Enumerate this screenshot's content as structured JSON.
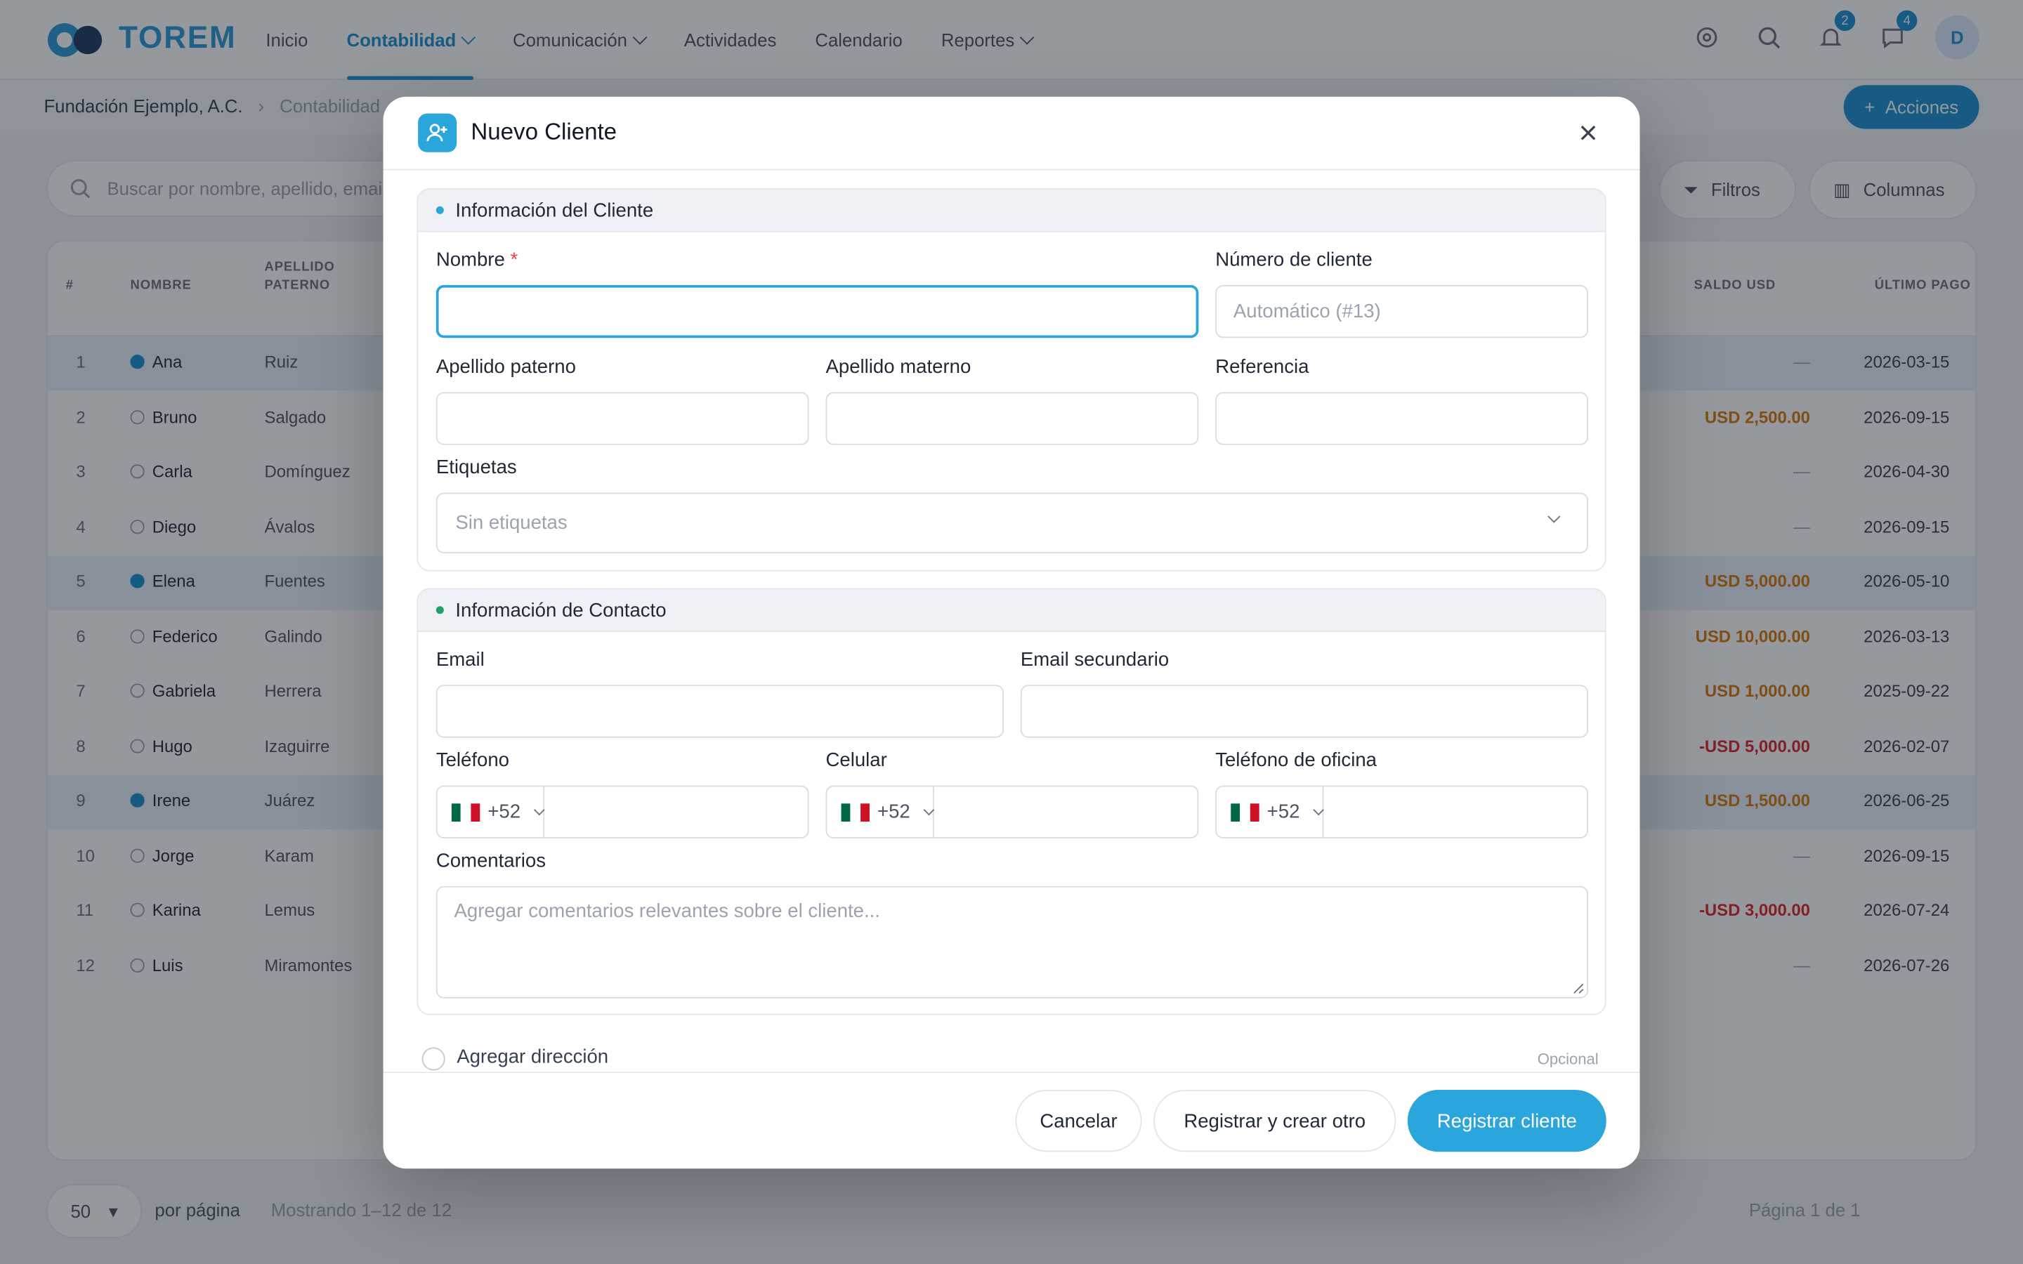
{
  "app": {
    "logo_text": "TOREM",
    "nav": [
      {
        "label": "Inicio",
        "active": false,
        "dropdown": false
      },
      {
        "label": "Contabilidad",
        "active": true,
        "dropdown": true
      },
      {
        "label": "Comunicación",
        "active": false,
        "dropdown": true
      },
      {
        "label": "Actividades",
        "active": false,
        "dropdown": false
      },
      {
        "label": "Calendario",
        "active": false,
        "dropdown": false
      },
      {
        "label": "Reportes",
        "active": false,
        "dropdown": true
      }
    ],
    "badges": {
      "notifications": "2",
      "messages": "4"
    },
    "avatar_initial": "D",
    "breadcrumb": {
      "org": "Fundación Ejemplo, A.C.",
      "section": "Contabilidad"
    },
    "actions_label": "Acciones",
    "search_placeholder": "Buscar por nombre, apellido, email...",
    "filters_label": "Filtros",
    "columns_label": "Columnas",
    "table": {
      "headers": [
        "#",
        "NOMBRE",
        "APELLIDO PATERNO",
        "SALDO USD",
        "ÚLTIMO PAGO"
      ],
      "rows": [
        {
          "n": "1",
          "name": "Ana",
          "last": "Ruiz",
          "selected": true,
          "usd": "—",
          "date": "2026-03-15"
        },
        {
          "n": "2",
          "name": "Bruno",
          "last": "Salgado",
          "selected": false,
          "usd": "USD 2,500.00",
          "date": "2026-09-15"
        },
        {
          "n": "3",
          "name": "Carla",
          "last": "Domínguez",
          "selected": false,
          "usd": "—",
          "date": "2026-04-30"
        },
        {
          "n": "4",
          "name": "Diego",
          "last": "Ávalos",
          "selected": false,
          "usd": "—",
          "date": "2026-09-15"
        },
        {
          "n": "5",
          "name": "Elena",
          "last": "Fuentes",
          "selected": true,
          "usd": "USD 5,000.00",
          "date": "2026-05-10"
        },
        {
          "n": "6",
          "name": "Federico",
          "last": "Galindo",
          "selected": false,
          "usd": "USD 10,000.00",
          "date": "2026-03-13"
        },
        {
          "n": "7",
          "name": "Gabriela",
          "last": "Herrera",
          "selected": false,
          "usd": "USD 1,000.00",
          "date": "2025-09-22"
        },
        {
          "n": "8",
          "name": "Hugo",
          "last": "Izaguirre",
          "selected": false,
          "usd": "-USD 5,000.00",
          "date": "2026-02-07"
        },
        {
          "n": "9",
          "name": "Irene",
          "last": "Juárez",
          "selected": true,
          "usd": "USD 1,500.00",
          "date": "2026-06-25"
        },
        {
          "n": "10",
          "name": "Jorge",
          "last": "Karam",
          "selected": false,
          "usd": "—",
          "date": "2026-09-15"
        },
        {
          "n": "11",
          "name": "Karina",
          "last": "Lemus",
          "selected": false,
          "usd": "-USD 3,000.00",
          "date": "2026-07-24"
        },
        {
          "n": "12",
          "name": "Luis",
          "last": "Miramontes",
          "selected": false,
          "usd": "—",
          "date": "2026-07-26"
        }
      ]
    },
    "footer": {
      "per_page": "50",
      "per_page_label": "por página",
      "showing": "Mostrando 1–12 de 12",
      "page": "Página 1 de 1"
    }
  },
  "modal": {
    "title": "Nuevo Cliente",
    "section_client": {
      "title": "Información del Cliente",
      "dot_color": "#2aa6dd",
      "nombre_label": "Nombre",
      "required_mark": "*",
      "nombre_value": "",
      "numero_label": "Número de cliente",
      "numero_placeholder": "Automático (#13)",
      "ap_paterno_label": "Apellido paterno",
      "ap_materno_label": "Apellido materno",
      "referencia_label": "Referencia",
      "etiquetas_label": "Etiquetas",
      "etiquetas_placeholder": "Sin etiquetas"
    },
    "section_contact": {
      "title": "Información de Contacto",
      "dot_color": "#22a06b",
      "email_label": "Email",
      "email2_label": "Email secundario",
      "telefono_label": "Teléfono",
      "celular_label": "Celular",
      "oficina_label": "Teléfono de oficina",
      "country_code": "+52",
      "comentarios_label": "Comentarios",
      "comentarios_placeholder": "Agregar comentarios relevantes sobre el cliente..."
    },
    "address": {
      "label": "Agregar dirección",
      "optional": "Opcional"
    },
    "buttons": {
      "cancel": "Cancelar",
      "save_new": "Registrar y crear otro",
      "save": "Registrar cliente"
    },
    "accent_color": "#2aa6dd"
  }
}
